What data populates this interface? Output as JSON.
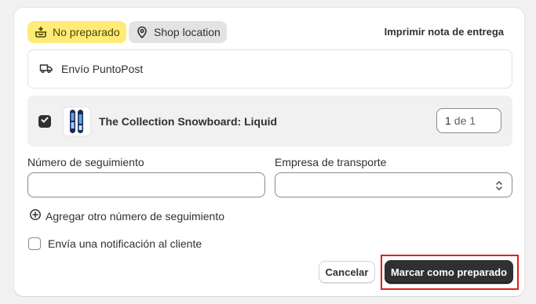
{
  "fulfillment": {
    "status_badge": "No preparado",
    "location_badge": "Shop location",
    "print_link": "Imprimir nota de entrega",
    "shipping_method": "Envío PuntoPost",
    "item": {
      "title": "The Collection Snowboard: Liquid",
      "quantity": "1",
      "quantity_of": "de 1",
      "checked": true
    },
    "tracking_label": "Número de seguimiento",
    "tracking_value": "",
    "carrier_label": "Empresa de transporte",
    "carrier_value": "",
    "add_tracking": "Agregar otro número de seguimiento",
    "notify_label": "Envía una notificación al cliente",
    "notify_checked": false,
    "cancel_label": "Cancelar",
    "submit_label": "Marcar como preparado"
  },
  "colors": {
    "status_badge_bg": "#ffeb78",
    "primary_button_bg": "#303030",
    "highlight_border": "#e51c1c"
  },
  "icons": {
    "status": "package-icon",
    "location": "location-pin-icon",
    "shipping": "delivery-truck-icon",
    "add": "plus-circle-icon",
    "select": "select-chevrons-icon"
  }
}
